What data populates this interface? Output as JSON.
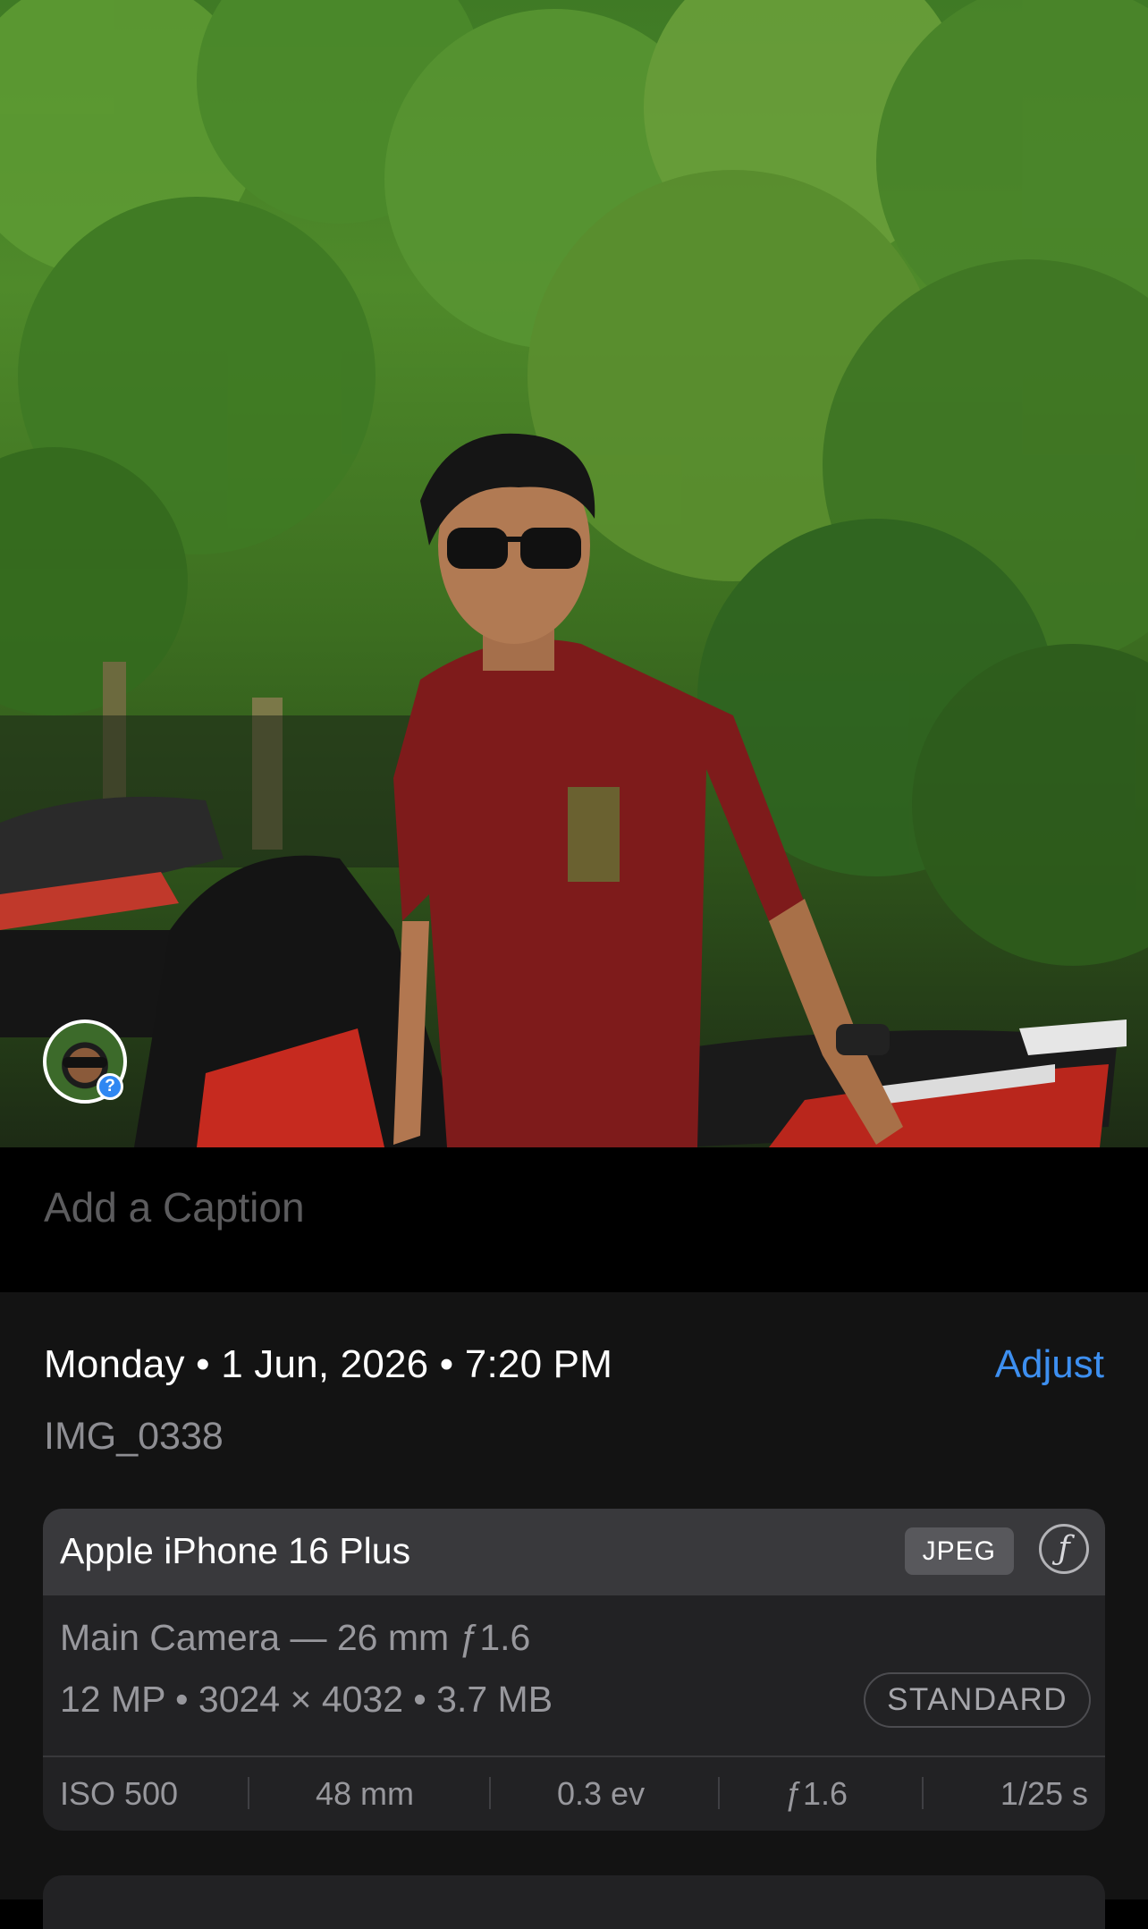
{
  "photo": {
    "face_badge": "?"
  },
  "caption": {
    "placeholder": "Add a Caption"
  },
  "info": {
    "date_line": "Monday • 1 Jun, 2026 • 7:20 PM",
    "adjust_label": "Adjust",
    "filename": "IMG_0338"
  },
  "camera": {
    "device": "Apple iPhone 16 Plus",
    "format": "JPEG",
    "lens": "Main Camera — 26 mm ƒ1.6",
    "specs": "12 MP • 3024 × 4032 • 3.7 MB",
    "style": "STANDARD",
    "exif": {
      "iso": "ISO 500",
      "focal": "48 mm",
      "ev": "0.3 ev",
      "aperture": "ƒ1.6",
      "shutter": "1/25 s"
    }
  },
  "colors": {
    "accent": "#3d8ff0",
    "panel": "#131313",
    "card": "#222224",
    "card_header": "#39393c"
  },
  "icons": [
    "person-face-thumbnail",
    "question-badge-icon",
    "f-aperture-icon"
  ]
}
